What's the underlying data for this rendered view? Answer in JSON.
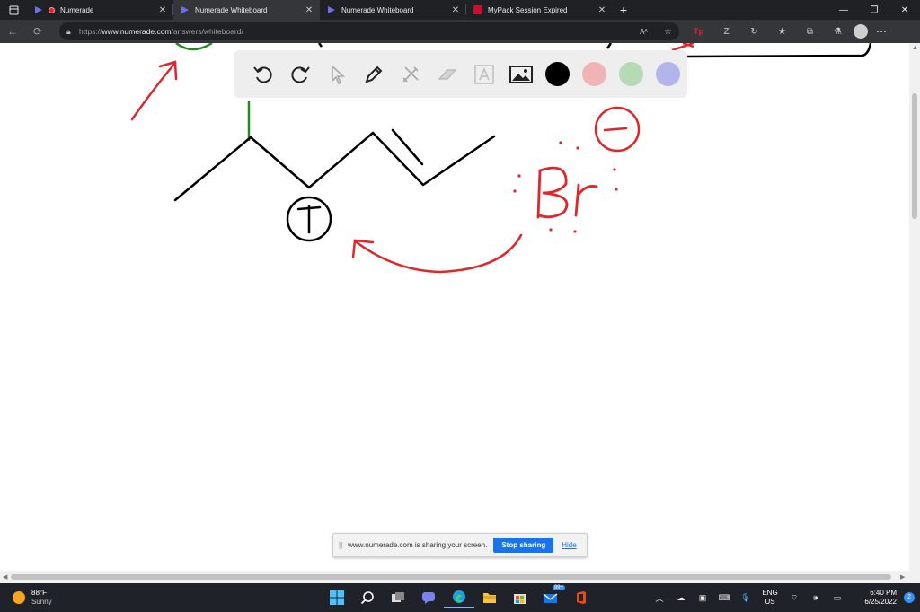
{
  "browser": {
    "tabs": [
      {
        "title": "Numerade",
        "active": false
      },
      {
        "title": "Numerade Whiteboard",
        "active": true
      },
      {
        "title": "Numerade Whiteboard",
        "active": false
      },
      {
        "title": "MyPack Session Expired",
        "active": false
      }
    ],
    "new_tab": "+",
    "url_prefix": "https://",
    "url_host": "www.numerade.com",
    "url_path": "/answers/whiteboard/"
  },
  "whiteboard": {
    "toolbar": {
      "tools": [
        "undo-icon",
        "redo-icon",
        "select-icon",
        "pen-icon",
        "tools-icon",
        "eraser-icon",
        "text-icon",
        "image-icon"
      ],
      "colors": [
        "#000000",
        "#f0b4b4",
        "#b6d9b6",
        "#b4b4ec"
      ]
    },
    "drawing": {
      "bromine_label": "Br",
      "plus_charge": "+",
      "minus_charge": "−"
    }
  },
  "screen_share": {
    "message": "www.numerade.com is sharing your screen.",
    "stop_label": "Stop sharing",
    "hide_label": "Hide"
  },
  "taskbar": {
    "weather_temp": "88°F",
    "weather_desc": "Sunny",
    "lang_top": "ENG",
    "lang_bottom": "US",
    "time": "6:40 PM",
    "date": "6/25/2022",
    "notification_count": "2",
    "store_badge": "99+"
  }
}
